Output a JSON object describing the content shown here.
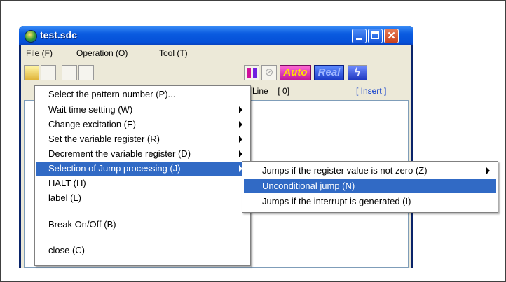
{
  "window": {
    "title": "test.sdc",
    "close_glyph": "✕"
  },
  "menubar": {
    "file": "File (F)",
    "operation": "Operation (O)",
    "tool": "Tool (T)"
  },
  "toolbar": {
    "auto_label": "Auto",
    "real_label": "Real",
    "bolt_glyph": "ϟ"
  },
  "status": {
    "line": "Line = [   0]",
    "mode": "[ Insert ]"
  },
  "context_menu": {
    "items": [
      "Select the pattern number (P)...",
      "Wait time setting (W)",
      "Change excitation (E)",
      "Set the variable register (R)",
      "Decrement the variable register (D)",
      "Selection of Jump processing (J)",
      "HALT (H)",
      "label (L)",
      "Break On/Off (B)",
      "close (C)"
    ]
  },
  "submenu": {
    "items": [
      "Jumps if the register value is not zero (Z)",
      "Unconditional jump (N)",
      "Jumps if the interrupt is generated (I)"
    ]
  },
  "colors": {
    "highlight": "#316ac5",
    "titlebar": "#0550d8"
  }
}
